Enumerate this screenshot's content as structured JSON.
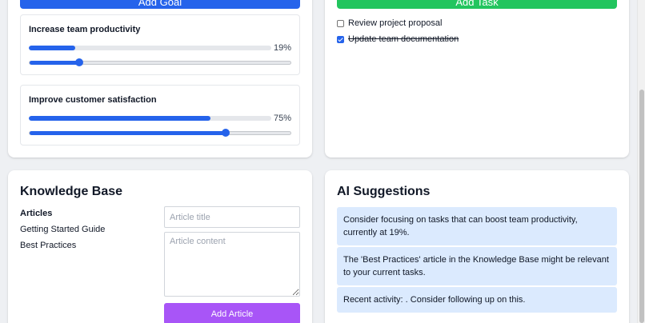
{
  "goals": {
    "add_button_label": "Add Goal",
    "items": [
      {
        "title": "Increase team productivity",
        "progress_label": "19%",
        "progress": 19
      },
      {
        "title": "Improve customer satisfaction",
        "progress_label": "75%",
        "progress": 75
      }
    ]
  },
  "tasks": {
    "add_button_label": "Add Task",
    "items": [
      {
        "label": "Review project proposal",
        "done": false
      },
      {
        "label": "Update team documentation",
        "done": true
      }
    ]
  },
  "knowledge_base": {
    "title": "Knowledge Base",
    "articles_heading": "Articles",
    "articles": [
      "Getting Started Guide",
      "Best Practices"
    ],
    "title_placeholder": "Article title",
    "content_placeholder": "Article content",
    "add_button_label": "Add Article"
  },
  "ai": {
    "title": "AI Suggestions",
    "suggestions": [
      "Consider focusing on tasks that can boost team productivity, currently at 19%.",
      "The 'Best Practices' article in the Knowledge Base might be relevant to your current tasks.",
      "Recent activity: . Consider following up on this."
    ]
  },
  "colors": {
    "primary": "#2563eb",
    "success": "#22c55e",
    "purple": "#a855f7",
    "suggestion_bg": "#dbeafe"
  }
}
